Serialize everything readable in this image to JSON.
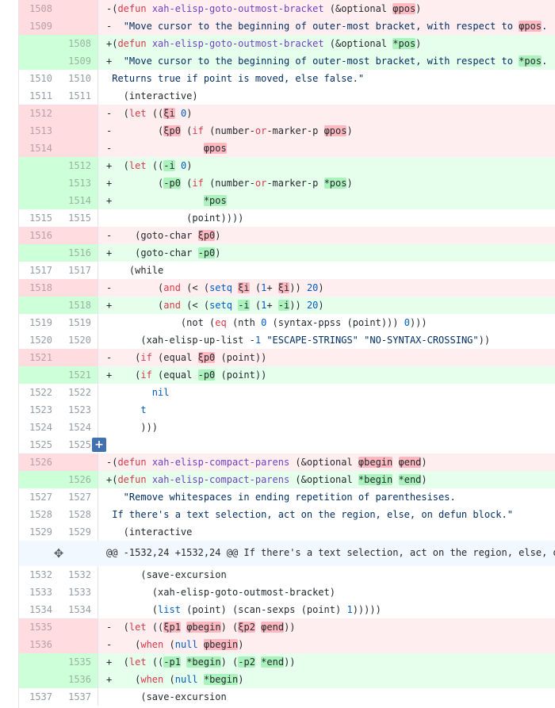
{
  "colors": {
    "del_bg": "#ffeef0",
    "add_bg": "#e6ffed",
    "hunk_bg": "#f1f8ff",
    "expand_button": "#4271ae"
  },
  "icons": {
    "expand_inline": "+",
    "expand_hunk": "✥"
  },
  "hunk": {
    "text": "@@ -1532,24 +1532,24 @@ If there's a text selection, act on the region, else, o"
  },
  "rows": [
    {
      "type": "del",
      "old": "1508",
      "new": "",
      "segs": [
        [
          "p",
          "-("
        ],
        [
          "k",
          "defun"
        ],
        [
          "p",
          " "
        ],
        [
          "f",
          "xah-elisp-goto-outmost-bracket"
        ],
        [
          "p",
          " (&optional "
        ],
        [
          "d",
          "φpos"
        ],
        [
          "p",
          ")"
        ]
      ]
    },
    {
      "type": "del",
      "old": "1509",
      "new": "",
      "segs": [
        [
          "p",
          "-  "
        ],
        [
          "s",
          "\"Move cursor to the beginning of outer-most bracket, with respect to "
        ],
        [
          "d",
          "φpos"
        ],
        [
          "s",
          "."
        ]
      ]
    },
    {
      "type": "add",
      "old": "",
      "new": "1508",
      "segs": [
        [
          "p",
          "+("
        ],
        [
          "k",
          "defun"
        ],
        [
          "p",
          " "
        ],
        [
          "f",
          "xah-elisp-goto-outmost-bracket"
        ],
        [
          "p",
          " (&optional "
        ],
        [
          "a",
          "*pos"
        ],
        [
          "p",
          ")"
        ]
      ]
    },
    {
      "type": "add",
      "old": "",
      "new": "1509",
      "segs": [
        [
          "p",
          "+  "
        ],
        [
          "s",
          "\"Move cursor to the beginning of outer-most bracket, with respect to "
        ],
        [
          "a",
          "*pos"
        ],
        [
          "s",
          "."
        ]
      ]
    },
    {
      "type": "ctx",
      "old": "1510",
      "new": "1510",
      "segs": [
        [
          "s",
          " Returns true if point is moved, else false.\""
        ]
      ]
    },
    {
      "type": "ctx",
      "old": "1511",
      "new": "1511",
      "segs": [
        [
          "p",
          "   (interactive)"
        ]
      ]
    },
    {
      "type": "del",
      "old": "1512",
      "new": "",
      "segs": [
        [
          "p",
          "-  ("
        ],
        [
          "k",
          "let"
        ],
        [
          "p",
          " (("
        ],
        [
          "d",
          "ξi"
        ],
        [
          "p",
          " "
        ],
        [
          "n",
          "0"
        ],
        [
          "p",
          ")"
        ]
      ]
    },
    {
      "type": "del",
      "old": "1513",
      "new": "",
      "segs": [
        [
          "p",
          "-        ("
        ],
        [
          "d",
          "ξp0"
        ],
        [
          "p",
          " ("
        ],
        [
          "k",
          "if"
        ],
        [
          "p",
          " (number-"
        ],
        [
          "k",
          "or"
        ],
        [
          "p",
          "-marker-p "
        ],
        [
          "d",
          "φpos"
        ],
        [
          "p",
          ")"
        ]
      ]
    },
    {
      "type": "del",
      "old": "1514",
      "new": "",
      "segs": [
        [
          "p",
          "-                "
        ],
        [
          "d",
          "φpos"
        ]
      ]
    },
    {
      "type": "add",
      "old": "",
      "new": "1512",
      "segs": [
        [
          "p",
          "+  ("
        ],
        [
          "k",
          "let"
        ],
        [
          "p",
          " (("
        ],
        [
          "a",
          "-i"
        ],
        [
          "p",
          " "
        ],
        [
          "n",
          "0"
        ],
        [
          "p",
          ")"
        ]
      ]
    },
    {
      "type": "add",
      "old": "",
      "new": "1513",
      "segs": [
        [
          "p",
          "+        ("
        ],
        [
          "a",
          "-p0"
        ],
        [
          "p",
          " ("
        ],
        [
          "k",
          "if"
        ],
        [
          "p",
          " (number-"
        ],
        [
          "k",
          "or"
        ],
        [
          "p",
          "-marker-p "
        ],
        [
          "a",
          "*pos"
        ],
        [
          "p",
          ")"
        ]
      ]
    },
    {
      "type": "add",
      "old": "",
      "new": "1514",
      "segs": [
        [
          "p",
          "+                "
        ],
        [
          "a",
          "*pos"
        ]
      ]
    },
    {
      "type": "ctx",
      "old": "1515",
      "new": "1515",
      "segs": [
        [
          "p",
          "              (point))))"
        ]
      ]
    },
    {
      "type": "del",
      "old": "1516",
      "new": "",
      "segs": [
        [
          "p",
          "-    (goto-char "
        ],
        [
          "d",
          "ξp0"
        ],
        [
          "p",
          ")"
        ]
      ]
    },
    {
      "type": "add",
      "old": "",
      "new": "1516",
      "segs": [
        [
          "p",
          "+    (goto-char "
        ],
        [
          "a",
          "-p0"
        ],
        [
          "p",
          ")"
        ]
      ]
    },
    {
      "type": "ctx",
      "old": "1517",
      "new": "1517",
      "segs": [
        [
          "p",
          "    (while"
        ]
      ]
    },
    {
      "type": "del",
      "old": "1518",
      "new": "",
      "segs": [
        [
          "p",
          "-        ("
        ],
        [
          "k",
          "and"
        ],
        [
          "p",
          " (< ("
        ],
        [
          "b",
          "setq"
        ],
        [
          "p",
          " "
        ],
        [
          "d",
          "ξi"
        ],
        [
          "p",
          " ("
        ],
        [
          "n",
          "1"
        ],
        [
          "p",
          "+ "
        ],
        [
          "d",
          "ξi"
        ],
        [
          "p",
          "))"
        ],
        [
          "p",
          " "
        ],
        [
          "n",
          "20"
        ],
        [
          "p",
          ")"
        ]
      ]
    },
    {
      "type": "add",
      "old": "",
      "new": "1518",
      "segs": [
        [
          "p",
          "+        ("
        ],
        [
          "k",
          "and"
        ],
        [
          "p",
          " (< ("
        ],
        [
          "b",
          "setq"
        ],
        [
          "p",
          " "
        ],
        [
          "a",
          "-i"
        ],
        [
          "p",
          " ("
        ],
        [
          "n",
          "1"
        ],
        [
          "p",
          "+ "
        ],
        [
          "a",
          "-i"
        ],
        [
          "p",
          "))"
        ],
        [
          "p",
          " "
        ],
        [
          "n",
          "20"
        ],
        [
          "p",
          ")"
        ]
      ]
    },
    {
      "type": "ctx",
      "old": "1519",
      "new": "1519",
      "segs": [
        [
          "p",
          "             (not ("
        ],
        [
          "k",
          "eq"
        ],
        [
          "p",
          " (nth "
        ],
        [
          "n",
          "0"
        ],
        [
          "p",
          " (syntax-ppss (point))) "
        ],
        [
          "n",
          "0"
        ],
        [
          "p",
          ")))"
        ]
      ]
    },
    {
      "type": "ctx",
      "old": "1520",
      "new": "1520",
      "segs": [
        [
          "p",
          "      (xah-elisp-up-list -"
        ],
        [
          "n",
          "1"
        ],
        [
          "p",
          " "
        ],
        [
          "s",
          "\"ESCAPE-STRINGS\""
        ],
        [
          "p",
          " "
        ],
        [
          "s",
          "\"NO-SYNTAX-CROSSING\""
        ],
        [
          "p",
          "))"
        ]
      ]
    },
    {
      "type": "del",
      "old": "1521",
      "new": "",
      "segs": [
        [
          "p",
          "-    ("
        ],
        [
          "k",
          "if"
        ],
        [
          "p",
          " (equal "
        ],
        [
          "d",
          "ξp0"
        ],
        [
          "p",
          " (point))"
        ]
      ]
    },
    {
      "type": "add",
      "old": "",
      "new": "1521",
      "segs": [
        [
          "p",
          "+    ("
        ],
        [
          "k",
          "if"
        ],
        [
          "p",
          " (equal "
        ],
        [
          "a",
          "-p0"
        ],
        [
          "p",
          " (point))"
        ]
      ]
    },
    {
      "type": "ctx",
      "old": "1522",
      "new": "1522",
      "segs": [
        [
          "b",
          "        nil"
        ]
      ]
    },
    {
      "type": "ctx",
      "old": "1523",
      "new": "1523",
      "segs": [
        [
          "b",
          "      t"
        ]
      ]
    },
    {
      "type": "ctx",
      "old": "1524",
      "new": "1524",
      "segs": [
        [
          "p",
          "      )))"
        ]
      ]
    },
    {
      "type": "ctx",
      "old": "1525",
      "new": "1525",
      "expand": true,
      "segs": []
    },
    {
      "type": "del",
      "old": "1526",
      "new": "",
      "segs": [
        [
          "p",
          "-("
        ],
        [
          "k",
          "defun"
        ],
        [
          "p",
          " "
        ],
        [
          "f",
          "xah-elisp-compact-parens"
        ],
        [
          "p",
          " (&optional "
        ],
        [
          "d",
          "φbegin"
        ],
        [
          "p",
          " "
        ],
        [
          "d",
          "φend"
        ],
        [
          "p",
          ")"
        ]
      ]
    },
    {
      "type": "add",
      "old": "",
      "new": "1526",
      "segs": [
        [
          "p",
          "+("
        ],
        [
          "k",
          "defun"
        ],
        [
          "p",
          " "
        ],
        [
          "f",
          "xah-elisp-compact-parens"
        ],
        [
          "p",
          " (&optional "
        ],
        [
          "a",
          "*begin"
        ],
        [
          "p",
          " "
        ],
        [
          "a",
          "*end"
        ],
        [
          "p",
          ")"
        ]
      ]
    },
    {
      "type": "ctx",
      "old": "1527",
      "new": "1527",
      "segs": [
        [
          "s",
          "   \"Remove whitespaces in ending repetition of parenthesises."
        ]
      ]
    },
    {
      "type": "ctx",
      "old": "1528",
      "new": "1528",
      "segs": [
        [
          "s",
          " If there's a text selection, act on the region, else, on defun block.\""
        ]
      ]
    },
    {
      "type": "ctx",
      "old": "1529",
      "new": "1529",
      "segs": [
        [
          "p",
          "   (interactive"
        ]
      ]
    },
    {
      "type": "hunk"
    },
    {
      "type": "ctx",
      "old": "1532",
      "new": "1532",
      "segs": [
        [
          "p",
          "      (save-excursion"
        ]
      ]
    },
    {
      "type": "ctx",
      "old": "1533",
      "new": "1533",
      "segs": [
        [
          "p",
          "        (xah-elisp-goto-outmost-bracket)"
        ]
      ]
    },
    {
      "type": "ctx",
      "old": "1534",
      "new": "1534",
      "segs": [
        [
          "p",
          "        ("
        ],
        [
          "b",
          "list"
        ],
        [
          "p",
          " (point) (scan-sexps (point) "
        ],
        [
          "n",
          "1"
        ],
        [
          "p",
          ")))))"
        ]
      ]
    },
    {
      "type": "del",
      "old": "1535",
      "new": "",
      "segs": [
        [
          "p",
          "-  ("
        ],
        [
          "k",
          "let"
        ],
        [
          "p",
          " (("
        ],
        [
          "d",
          "ξp1"
        ],
        [
          "p",
          " "
        ],
        [
          "d",
          "φbegin"
        ],
        [
          "p",
          ") ("
        ],
        [
          "d",
          "ξp2"
        ],
        [
          "p",
          " "
        ],
        [
          "d",
          "φend"
        ],
        [
          "p",
          "))"
        ]
      ]
    },
    {
      "type": "del",
      "old": "1536",
      "new": "",
      "segs": [
        [
          "p",
          "-    ("
        ],
        [
          "k",
          "when"
        ],
        [
          "p",
          " ("
        ],
        [
          "b",
          "null"
        ],
        [
          "p",
          " "
        ],
        [
          "d",
          "φbegin"
        ],
        [
          "p",
          ")"
        ]
      ]
    },
    {
      "type": "add",
      "old": "",
      "new": "1535",
      "segs": [
        [
          "p",
          "+  ("
        ],
        [
          "k",
          "let"
        ],
        [
          "p",
          " (("
        ],
        [
          "a",
          "-p1"
        ],
        [
          "p",
          " "
        ],
        [
          "a",
          "*begin"
        ],
        [
          "p",
          ") ("
        ],
        [
          "a",
          "-p2"
        ],
        [
          "p",
          " "
        ],
        [
          "a",
          "*end"
        ],
        [
          "p",
          "))"
        ]
      ]
    },
    {
      "type": "add",
      "old": "",
      "new": "1536",
      "segs": [
        [
          "p",
          "+    ("
        ],
        [
          "k",
          "when"
        ],
        [
          "p",
          " ("
        ],
        [
          "b",
          "null"
        ],
        [
          "p",
          " "
        ],
        [
          "a",
          "*begin"
        ],
        [
          "p",
          ")"
        ]
      ]
    },
    {
      "type": "ctx",
      "old": "1537",
      "new": "1537",
      "segs": [
        [
          "p",
          "      (save-excursion"
        ]
      ]
    }
  ]
}
